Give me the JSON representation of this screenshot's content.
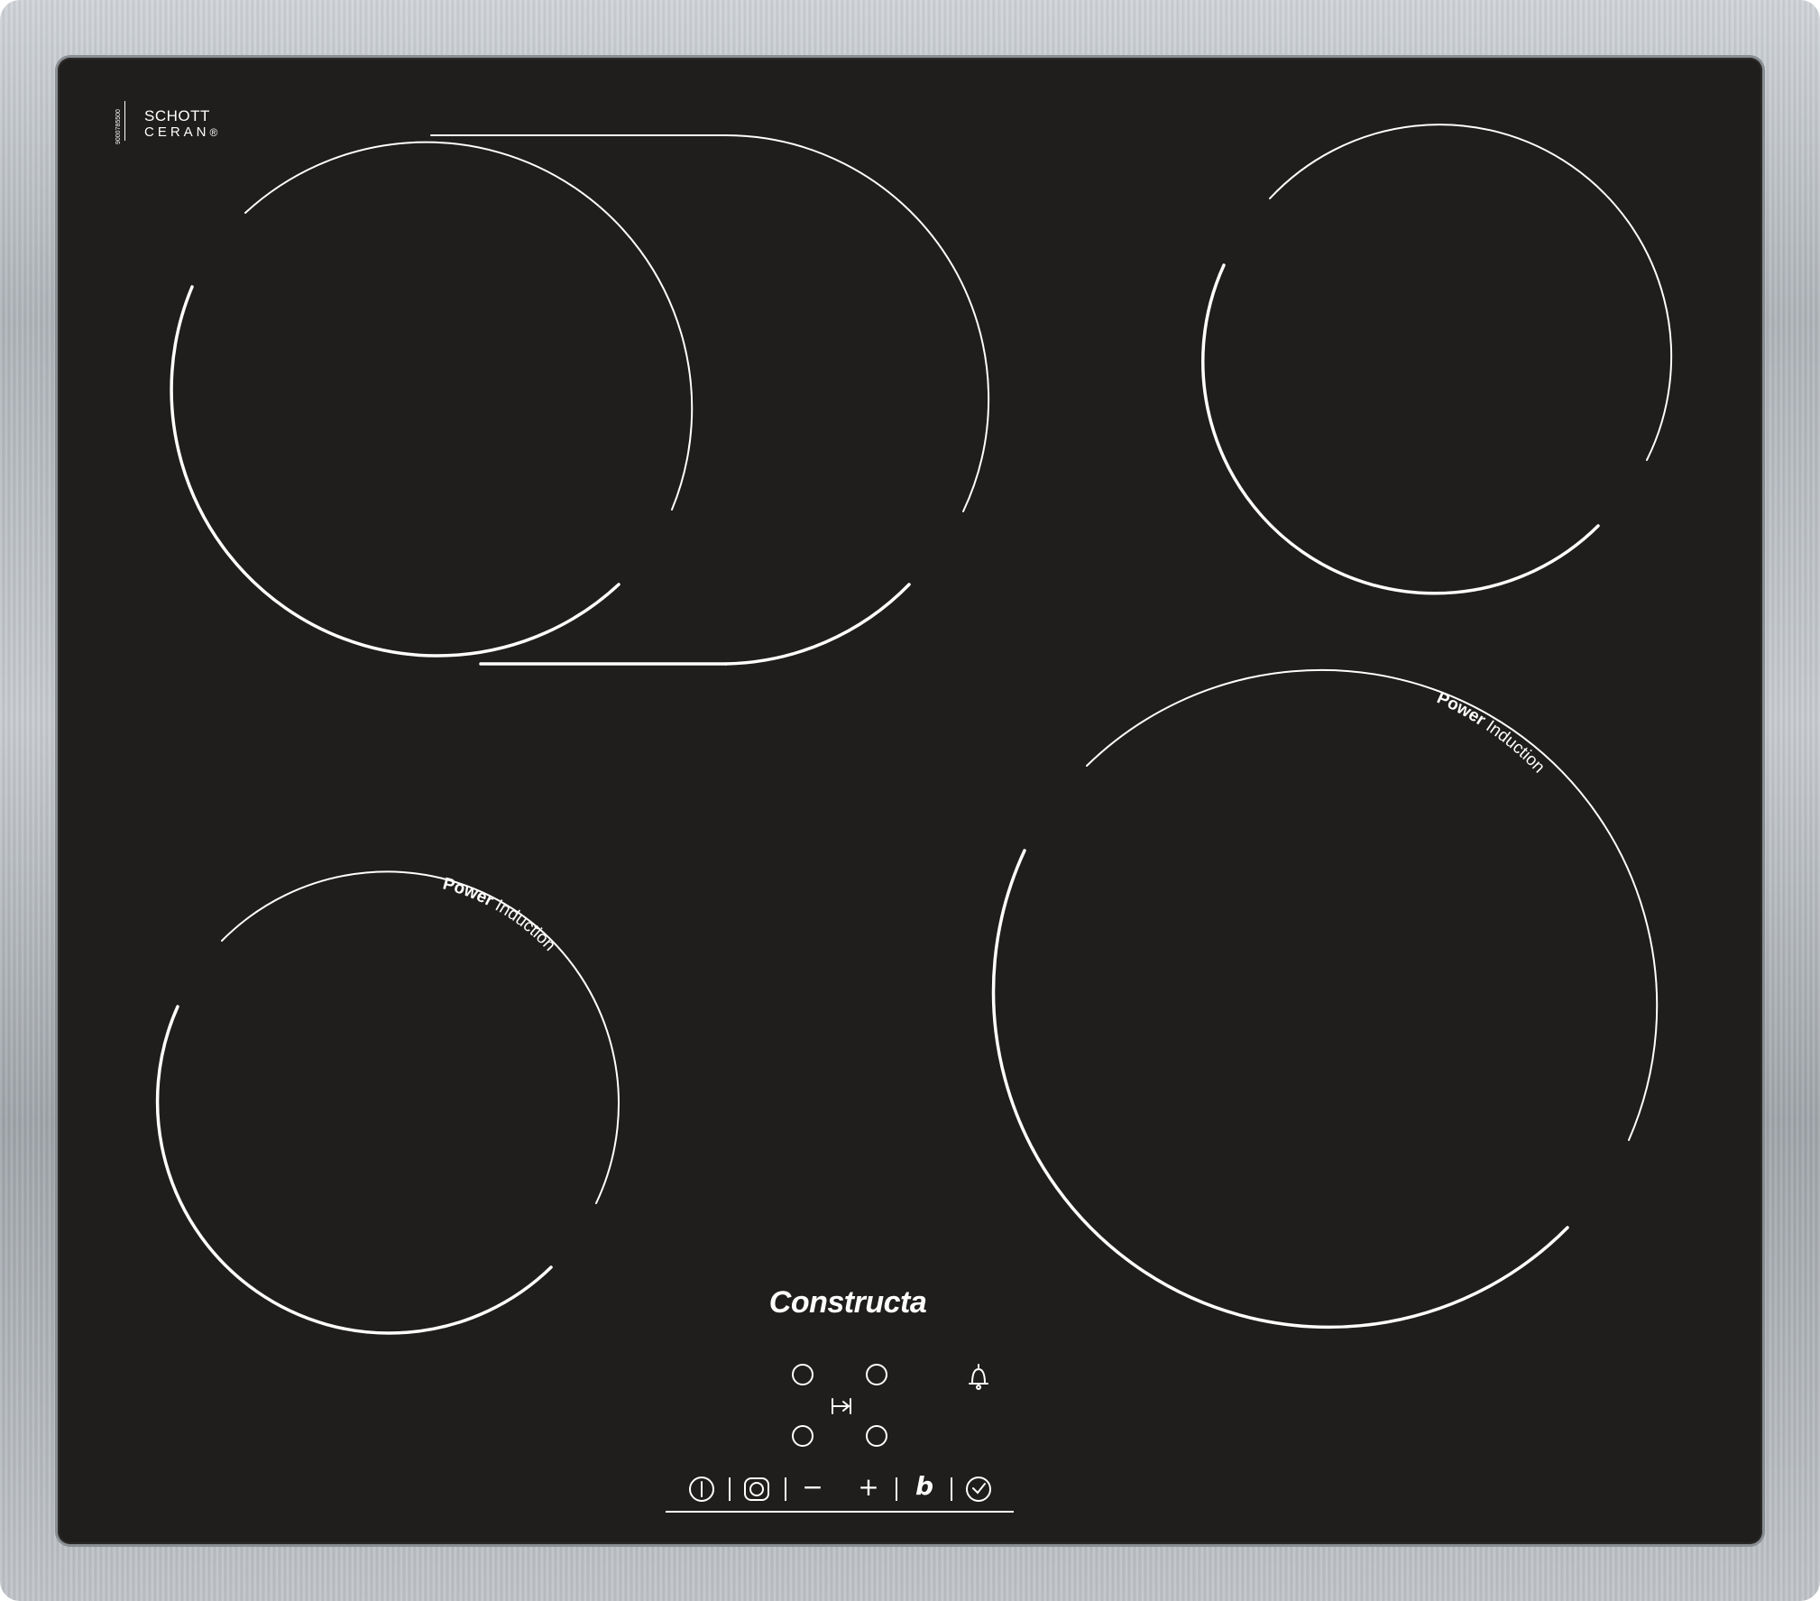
{
  "product": {
    "brand": "Constructa",
    "glass_brand_line1": "SCHOTT",
    "glass_brand_line2": "CERAN",
    "glass_brand_mark": "®",
    "serial": "9000785500"
  },
  "zones": [
    {
      "name": "dual-oval-zone",
      "label_bold": "",
      "label_regular": ""
    },
    {
      "name": "rear-right-zone",
      "label_bold": "",
      "label_regular": ""
    },
    {
      "name": "front-left-zone",
      "label_bold": "Power",
      "label_regular": " Induction"
    },
    {
      "name": "front-right-zone",
      "label_bold": "Power",
      "label_regular": " Induction"
    }
  ],
  "controls": {
    "icons": {
      "power": "power-icon",
      "zone_select": "zone-select-icon",
      "minus": "−",
      "plus": "+",
      "boost": "b",
      "timer": "timer-icon",
      "bell": "bell-icon",
      "arrow_to": "↦"
    }
  },
  "colors": {
    "glass": "#1f1e1c",
    "marking": "#ffffff",
    "frame": "#b4b8bc"
  }
}
